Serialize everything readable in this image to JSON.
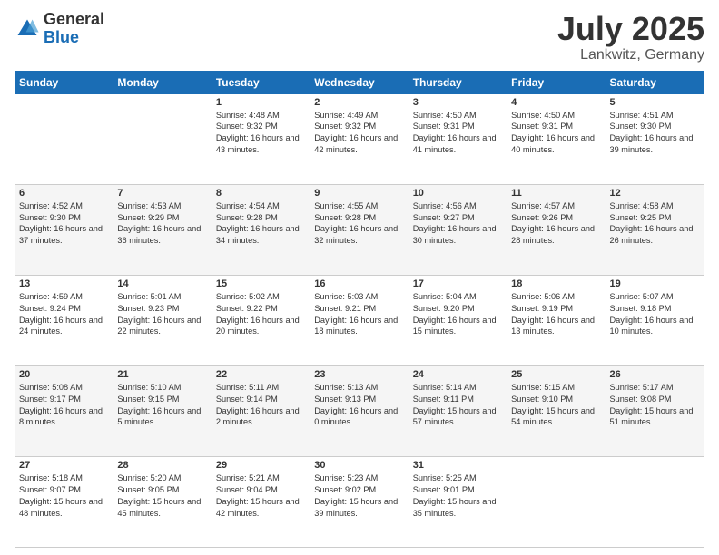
{
  "header": {
    "logo_general": "General",
    "logo_blue": "Blue",
    "title": "July 2025",
    "location": "Lankwitz, Germany"
  },
  "days_of_week": [
    "Sunday",
    "Monday",
    "Tuesday",
    "Wednesday",
    "Thursday",
    "Friday",
    "Saturday"
  ],
  "weeks": [
    [
      {
        "day": "",
        "sunrise": "",
        "sunset": "",
        "daylight": ""
      },
      {
        "day": "",
        "sunrise": "",
        "sunset": "",
        "daylight": ""
      },
      {
        "day": "1",
        "sunrise": "Sunrise: 4:48 AM",
        "sunset": "Sunset: 9:32 PM",
        "daylight": "Daylight: 16 hours and 43 minutes."
      },
      {
        "day": "2",
        "sunrise": "Sunrise: 4:49 AM",
        "sunset": "Sunset: 9:32 PM",
        "daylight": "Daylight: 16 hours and 42 minutes."
      },
      {
        "day": "3",
        "sunrise": "Sunrise: 4:50 AM",
        "sunset": "Sunset: 9:31 PM",
        "daylight": "Daylight: 16 hours and 41 minutes."
      },
      {
        "day": "4",
        "sunrise": "Sunrise: 4:50 AM",
        "sunset": "Sunset: 9:31 PM",
        "daylight": "Daylight: 16 hours and 40 minutes."
      },
      {
        "day": "5",
        "sunrise": "Sunrise: 4:51 AM",
        "sunset": "Sunset: 9:30 PM",
        "daylight": "Daylight: 16 hours and 39 minutes."
      }
    ],
    [
      {
        "day": "6",
        "sunrise": "Sunrise: 4:52 AM",
        "sunset": "Sunset: 9:30 PM",
        "daylight": "Daylight: 16 hours and 37 minutes."
      },
      {
        "day": "7",
        "sunrise": "Sunrise: 4:53 AM",
        "sunset": "Sunset: 9:29 PM",
        "daylight": "Daylight: 16 hours and 36 minutes."
      },
      {
        "day": "8",
        "sunrise": "Sunrise: 4:54 AM",
        "sunset": "Sunset: 9:28 PM",
        "daylight": "Daylight: 16 hours and 34 minutes."
      },
      {
        "day": "9",
        "sunrise": "Sunrise: 4:55 AM",
        "sunset": "Sunset: 9:28 PM",
        "daylight": "Daylight: 16 hours and 32 minutes."
      },
      {
        "day": "10",
        "sunrise": "Sunrise: 4:56 AM",
        "sunset": "Sunset: 9:27 PM",
        "daylight": "Daylight: 16 hours and 30 minutes."
      },
      {
        "day": "11",
        "sunrise": "Sunrise: 4:57 AM",
        "sunset": "Sunset: 9:26 PM",
        "daylight": "Daylight: 16 hours and 28 minutes."
      },
      {
        "day": "12",
        "sunrise": "Sunrise: 4:58 AM",
        "sunset": "Sunset: 9:25 PM",
        "daylight": "Daylight: 16 hours and 26 minutes."
      }
    ],
    [
      {
        "day": "13",
        "sunrise": "Sunrise: 4:59 AM",
        "sunset": "Sunset: 9:24 PM",
        "daylight": "Daylight: 16 hours and 24 minutes."
      },
      {
        "day": "14",
        "sunrise": "Sunrise: 5:01 AM",
        "sunset": "Sunset: 9:23 PM",
        "daylight": "Daylight: 16 hours and 22 minutes."
      },
      {
        "day": "15",
        "sunrise": "Sunrise: 5:02 AM",
        "sunset": "Sunset: 9:22 PM",
        "daylight": "Daylight: 16 hours and 20 minutes."
      },
      {
        "day": "16",
        "sunrise": "Sunrise: 5:03 AM",
        "sunset": "Sunset: 9:21 PM",
        "daylight": "Daylight: 16 hours and 18 minutes."
      },
      {
        "day": "17",
        "sunrise": "Sunrise: 5:04 AM",
        "sunset": "Sunset: 9:20 PM",
        "daylight": "Daylight: 16 hours and 15 minutes."
      },
      {
        "day": "18",
        "sunrise": "Sunrise: 5:06 AM",
        "sunset": "Sunset: 9:19 PM",
        "daylight": "Daylight: 16 hours and 13 minutes."
      },
      {
        "day": "19",
        "sunrise": "Sunrise: 5:07 AM",
        "sunset": "Sunset: 9:18 PM",
        "daylight": "Daylight: 16 hours and 10 minutes."
      }
    ],
    [
      {
        "day": "20",
        "sunrise": "Sunrise: 5:08 AM",
        "sunset": "Sunset: 9:17 PM",
        "daylight": "Daylight: 16 hours and 8 minutes."
      },
      {
        "day": "21",
        "sunrise": "Sunrise: 5:10 AM",
        "sunset": "Sunset: 9:15 PM",
        "daylight": "Daylight: 16 hours and 5 minutes."
      },
      {
        "day": "22",
        "sunrise": "Sunrise: 5:11 AM",
        "sunset": "Sunset: 9:14 PM",
        "daylight": "Daylight: 16 hours and 2 minutes."
      },
      {
        "day": "23",
        "sunrise": "Sunrise: 5:13 AM",
        "sunset": "Sunset: 9:13 PM",
        "daylight": "Daylight: 16 hours and 0 minutes."
      },
      {
        "day": "24",
        "sunrise": "Sunrise: 5:14 AM",
        "sunset": "Sunset: 9:11 PM",
        "daylight": "Daylight: 15 hours and 57 minutes."
      },
      {
        "day": "25",
        "sunrise": "Sunrise: 5:15 AM",
        "sunset": "Sunset: 9:10 PM",
        "daylight": "Daylight: 15 hours and 54 minutes."
      },
      {
        "day": "26",
        "sunrise": "Sunrise: 5:17 AM",
        "sunset": "Sunset: 9:08 PM",
        "daylight": "Daylight: 15 hours and 51 minutes."
      }
    ],
    [
      {
        "day": "27",
        "sunrise": "Sunrise: 5:18 AM",
        "sunset": "Sunset: 9:07 PM",
        "daylight": "Daylight: 15 hours and 48 minutes."
      },
      {
        "day": "28",
        "sunrise": "Sunrise: 5:20 AM",
        "sunset": "Sunset: 9:05 PM",
        "daylight": "Daylight: 15 hours and 45 minutes."
      },
      {
        "day": "29",
        "sunrise": "Sunrise: 5:21 AM",
        "sunset": "Sunset: 9:04 PM",
        "daylight": "Daylight: 15 hours and 42 minutes."
      },
      {
        "day": "30",
        "sunrise": "Sunrise: 5:23 AM",
        "sunset": "Sunset: 9:02 PM",
        "daylight": "Daylight: 15 hours and 39 minutes."
      },
      {
        "day": "31",
        "sunrise": "Sunrise: 5:25 AM",
        "sunset": "Sunset: 9:01 PM",
        "daylight": "Daylight: 15 hours and 35 minutes."
      },
      {
        "day": "",
        "sunrise": "",
        "sunset": "",
        "daylight": ""
      },
      {
        "day": "",
        "sunrise": "",
        "sunset": "",
        "daylight": ""
      }
    ]
  ]
}
